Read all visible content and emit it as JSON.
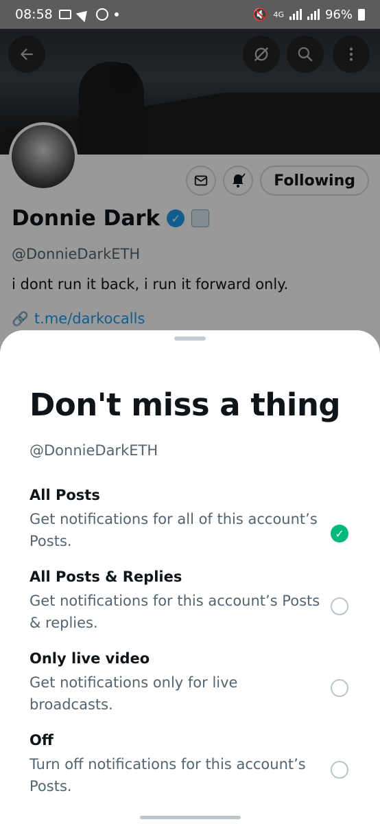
{
  "status_bar": {
    "time": "08:58",
    "network": "4G",
    "battery": "96%"
  },
  "profile": {
    "name": "Donnie Dark",
    "handle": "@DonnieDarkETH",
    "bio": "i dont run it back, i run it forward only.",
    "link": "t.me/darkocalls",
    "following_label": "Following"
  },
  "sheet": {
    "title": "Don't miss a thing",
    "handle": "@DonnieDarkETH",
    "options": [
      {
        "title": "All Posts",
        "description": "Get notifications for all of this account’s Posts.",
        "selected": true
      },
      {
        "title": "All Posts & Replies",
        "description": "Get notifications for this account’s Posts & replies.",
        "selected": false
      },
      {
        "title": "Only live video",
        "description": "Get notifications only for live broadcasts.",
        "selected": false
      },
      {
        "title": "Off",
        "description": "Turn off notifications for this account’s Posts.",
        "selected": false
      }
    ]
  },
  "colors": {
    "accent": "#1d9bf0",
    "selected": "#00ba7c",
    "text_primary": "#0f1419",
    "text_secondary": "#536471"
  },
  "icons": {
    "back": "arrow-left-icon",
    "grok": "grok-icon",
    "search": "search-icon",
    "more": "more-vertical-icon",
    "message": "envelope-icon",
    "notifications": "bell-check-icon",
    "verified": "verified-badge-icon",
    "link": "link-icon",
    "check": "check-icon"
  }
}
